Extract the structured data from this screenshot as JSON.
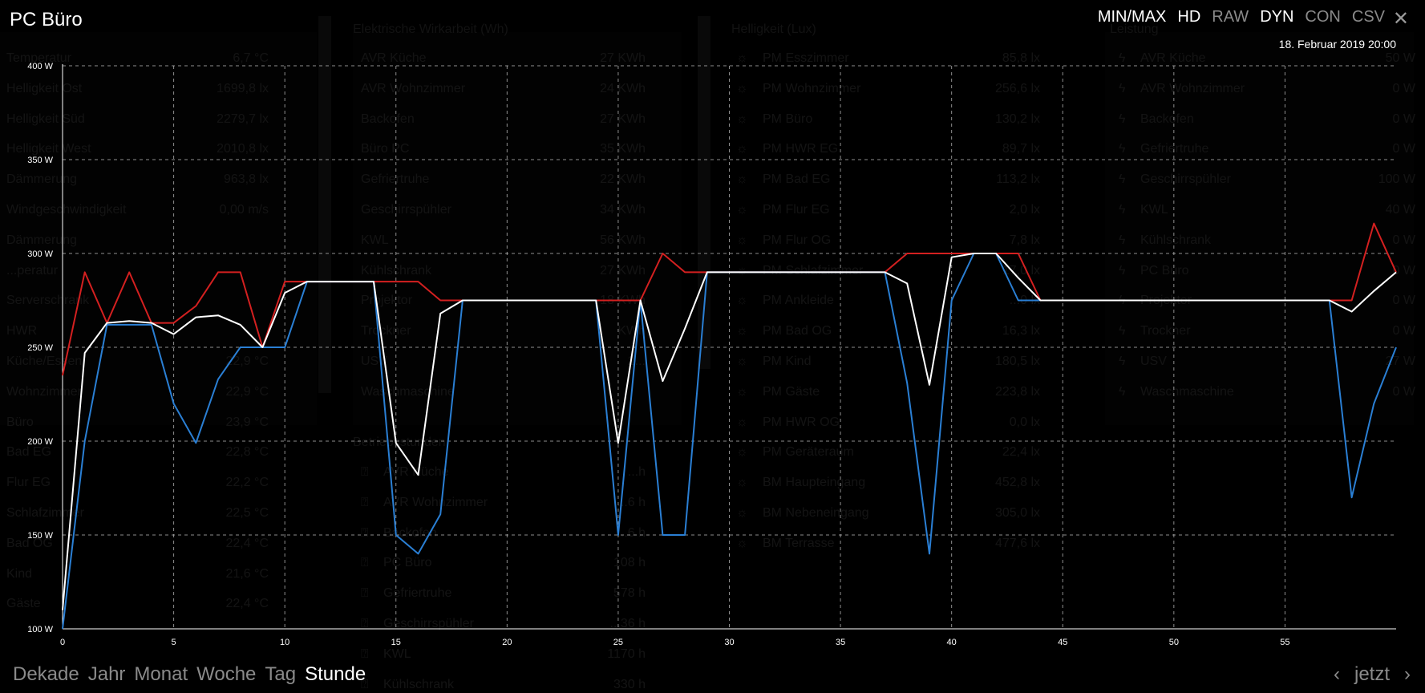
{
  "header": {
    "title": "PC Büro",
    "toolbar": [
      {
        "label": "MIN/MAX",
        "active": true
      },
      {
        "label": "HD",
        "active": true
      },
      {
        "label": "RAW",
        "active": false
      },
      {
        "label": "DYN",
        "active": true
      },
      {
        "label": "CON",
        "active": false
      },
      {
        "label": "CSV",
        "active": false
      }
    ],
    "close_icon": "close-icon",
    "datetime": "18. Februar 2019 20:00"
  },
  "footer": {
    "ranges": [
      {
        "label": "Dekade",
        "active": false
      },
      {
        "label": "Jahr",
        "active": false
      },
      {
        "label": "Monat",
        "active": false
      },
      {
        "label": "Woche",
        "active": false
      },
      {
        "label": "Tag",
        "active": false
      },
      {
        "label": "Stunde",
        "active": true
      }
    ],
    "prev_icon": "chevron-left-icon",
    "now_label": "jetzt",
    "next_icon": "chevron-right-icon"
  },
  "background": {
    "col1": {
      "rows": [
        {
          "label": "Temperatur",
          "value": "6,7 °C"
        },
        {
          "label": "Helligkeit Ost",
          "value": "1699,8 lx"
        },
        {
          "label": "Helligkeit Süd",
          "value": "2279,7 lx"
        },
        {
          "label": "Helligkeit West",
          "value": "2010,8 lx"
        },
        {
          "label": "Dämmerung",
          "value": "963,8 lx"
        },
        {
          "label": "Windgeschwindigkeit",
          "value": "0,00 m/s"
        },
        {
          "label": "Dämmerung",
          "value": ""
        },
        {
          "label": "...peratur",
          "value": ""
        },
        {
          "label": "Serverschrank",
          "value": ""
        },
        {
          "label": "HWR",
          "value": ""
        },
        {
          "label": "Küche/Essen",
          "value": "22,9 °C"
        },
        {
          "label": "Wohnzimmer",
          "value": "22,9 °C"
        },
        {
          "label": "Büro",
          "value": "23,9 °C"
        },
        {
          "label": "Bad EG",
          "value": "22,8 °C"
        },
        {
          "label": "Flur EG",
          "value": "22,2 °C"
        },
        {
          "label": "Schlafzimmer",
          "value": "22,5 °C"
        },
        {
          "label": "Bad OG",
          "value": "22,4 °C"
        },
        {
          "label": "Kind",
          "value": "21,6 °C"
        },
        {
          "label": "Gäste",
          "value": "22,4 °C"
        }
      ]
    },
    "col2": {
      "heading": "Elektrische Wirkarbeit (Wh)",
      "rows": [
        {
          "label": "AVR Küche",
          "value": "27 KWh"
        },
        {
          "label": "AVR Wohnzimmer",
          "value": "24 KWh"
        },
        {
          "label": "Backofen",
          "value": "27 KWh"
        },
        {
          "label": "Büro PC",
          "value": "35 KWh"
        },
        {
          "label": "Gefriertruhe",
          "value": "22 KWh"
        },
        {
          "label": "Geschirrspühler",
          "value": "34 KWh"
        },
        {
          "label": "KWL",
          "value": "56 KWh"
        },
        {
          "label": "Kühlschrank",
          "value": "27 KWh"
        },
        {
          "label": "Projektor",
          "value": "18 KWh"
        },
        {
          "label": "Trockner",
          "value": "KWh"
        },
        {
          "label": "USV",
          "value": "2..."
        },
        {
          "label": "Waschmaschine",
          "value": ""
        }
      ],
      "heading2": "Betriebsstunden",
      "rows2": [
        {
          "label": "AVR Küche",
          "value": "...h"
        },
        {
          "label": "AVR Wohnzimmer",
          "value": "...6 h"
        },
        {
          "label": "Backofen",
          "value": "...6 h"
        },
        {
          "label": "PC Büro",
          "value": "108 h"
        },
        {
          "label": "Gefriertruhe",
          "value": "578 h"
        },
        {
          "label": "Geschirrspühler",
          "value": "...36 h"
        },
        {
          "label": "KWL",
          "value": "1170 h"
        },
        {
          "label": "Kühlschrank",
          "value": "330 h"
        }
      ]
    },
    "col3": {
      "heading": "Helligkeit (Lux)",
      "rows": [
        {
          "label": "PM Esszimmer",
          "value": "85,8 lx"
        },
        {
          "label": "PM Wohnzimmer",
          "value": "256,6 lx"
        },
        {
          "label": "PM Büro",
          "value": "130,2 lx"
        },
        {
          "label": "PM HWR EG",
          "value": "89,7 lx"
        },
        {
          "label": "PM Bad EG",
          "value": "113,2 lx"
        },
        {
          "label": "PM Flur EG",
          "value": "2,0 lx"
        },
        {
          "label": "PM Flur OG",
          "value": "7,8 lx"
        },
        {
          "label": "PM Schlafzimmer",
          "value": "17,0 lx"
        },
        {
          "label": "PM Ankleide",
          "value": "...0 lx"
        },
        {
          "label": "PM Bad OG",
          "value": "16,3 lx"
        },
        {
          "label": "PM Kind",
          "value": "180,5 lx"
        },
        {
          "label": "PM Gäste",
          "value": "223,8 lx"
        },
        {
          "label": "PM HWR OG",
          "value": "0,0 lx"
        },
        {
          "label": "PM Geräteraum",
          "value": "22,4 lx"
        },
        {
          "label": "BM Haupteingang",
          "value": "452,8 lx"
        },
        {
          "label": "BM Nebeneingang",
          "value": "305,0 lx"
        },
        {
          "label": "BM Terrasse",
          "value": "477,6 lx"
        }
      ]
    },
    "col4": {
      "heading": "Leistung",
      "rows": [
        {
          "label": "AVR Küche",
          "value": "50 W"
        },
        {
          "label": "AVR Wohnzimmer",
          "value": "0 W"
        },
        {
          "label": "Backofen",
          "value": "0 W"
        },
        {
          "label": "Gefriertruhe",
          "value": "0 W"
        },
        {
          "label": "Geschirrspühler",
          "value": "100 W"
        },
        {
          "label": "KWL",
          "value": "40 W"
        },
        {
          "label": "Kühlschrank",
          "value": "0 W"
        },
        {
          "label": "PC Büro",
          "value": "0 W"
        },
        {
          "label": "Projektor",
          "value": "0 W"
        },
        {
          "label": "Trockner",
          "value": "0 W"
        },
        {
          "label": "USV",
          "value": "27 W"
        },
        {
          "label": "Waschmaschine",
          "value": "0 W"
        }
      ]
    }
  },
  "chart_data": {
    "type": "line",
    "title": "",
    "xlabel": "",
    "ylabel": "",
    "xlim": [
      0,
      60
    ],
    "ylim": [
      100,
      400
    ],
    "y_ticks": [
      "100 W",
      "150 W",
      "200 W",
      "250 W",
      "300 W",
      "350 W",
      "400 W"
    ],
    "y_tick_values": [
      100,
      150,
      200,
      250,
      300,
      350,
      400
    ],
    "x_ticks": [
      0,
      5,
      10,
      15,
      20,
      25,
      30,
      35,
      40,
      45,
      50,
      55
    ],
    "grid": true,
    "series": [
      {
        "role": "max",
        "color": "#d42020",
        "x": [
          0,
          1,
          2,
          3,
          4,
          5,
          6,
          7,
          8,
          9,
          10,
          11,
          12,
          13,
          14,
          15,
          16,
          17,
          18,
          19,
          20,
          21,
          22,
          23,
          24,
          25,
          26,
          27,
          28,
          29,
          30,
          31,
          32,
          33,
          34,
          35,
          36,
          37,
          38,
          39,
          40,
          41,
          42,
          43,
          44,
          45,
          46,
          47,
          48,
          49,
          50,
          51,
          52,
          53,
          54,
          55,
          56,
          57,
          58,
          59,
          60
        ],
        "y": [
          235,
          290,
          263,
          290,
          263,
          263,
          272,
          290,
          290,
          250,
          285,
          285,
          285,
          285,
          285,
          285,
          285,
          275,
          275,
          275,
          275,
          275,
          275,
          275,
          275,
          275,
          275,
          300,
          290,
          290,
          290,
          290,
          290,
          290,
          290,
          290,
          290,
          290,
          300,
          300,
          300,
          300,
          300,
          300,
          275,
          275,
          275,
          275,
          275,
          275,
          275,
          275,
          275,
          275,
          275,
          275,
          275,
          275,
          275,
          316,
          290
        ]
      },
      {
        "role": "avg",
        "color": "#ffffff",
        "x": [
          0,
          1,
          2,
          3,
          4,
          5,
          6,
          7,
          8,
          9,
          10,
          11,
          12,
          13,
          14,
          15,
          16,
          17,
          18,
          19,
          20,
          21,
          22,
          23,
          24,
          25,
          26,
          27,
          28,
          29,
          30,
          31,
          32,
          33,
          34,
          35,
          36,
          37,
          38,
          39,
          40,
          41,
          42,
          43,
          44,
          45,
          46,
          47,
          48,
          49,
          50,
          51,
          52,
          53,
          54,
          55,
          56,
          57,
          58,
          59,
          60
        ],
        "y": [
          110,
          247,
          263,
          264,
          263,
          257,
          266,
          267,
          262,
          250,
          279,
          285,
          285,
          285,
          285,
          199,
          182,
          268,
          275,
          275,
          275,
          275,
          275,
          275,
          275,
          199,
          275,
          232,
          260,
          290,
          290,
          290,
          290,
          290,
          290,
          290,
          290,
          290,
          284,
          230,
          298,
          300,
          300,
          287,
          275,
          275,
          275,
          275,
          275,
          275,
          275,
          275,
          275,
          275,
          275,
          275,
          275,
          275,
          269,
          280,
          290
        ]
      },
      {
        "role": "min",
        "color": "#2a7fd4",
        "x": [
          0,
          1,
          2,
          3,
          4,
          5,
          6,
          7,
          8,
          9,
          10,
          11,
          12,
          13,
          14,
          15,
          16,
          17,
          18,
          19,
          20,
          21,
          22,
          23,
          24,
          25,
          26,
          27,
          28,
          29,
          30,
          31,
          32,
          33,
          34,
          35,
          36,
          37,
          38,
          39,
          40,
          41,
          42,
          43,
          44,
          45,
          46,
          47,
          48,
          49,
          50,
          51,
          52,
          53,
          54,
          55,
          56,
          57,
          58,
          59,
          60
        ],
        "y": [
          100,
          200,
          262,
          262,
          262,
          220,
          199,
          233,
          250,
          250,
          250,
          285,
          285,
          285,
          285,
          150,
          140,
          161,
          275,
          275,
          275,
          275,
          275,
          275,
          275,
          150,
          275,
          150,
          150,
          290,
          290,
          290,
          290,
          290,
          290,
          290,
          290,
          290,
          231,
          140,
          275,
          300,
          300,
          275,
          275,
          275,
          275,
          275,
          275,
          275,
          275,
          275,
          275,
          275,
          275,
          275,
          275,
          275,
          170,
          220,
          250
        ]
      }
    ]
  }
}
